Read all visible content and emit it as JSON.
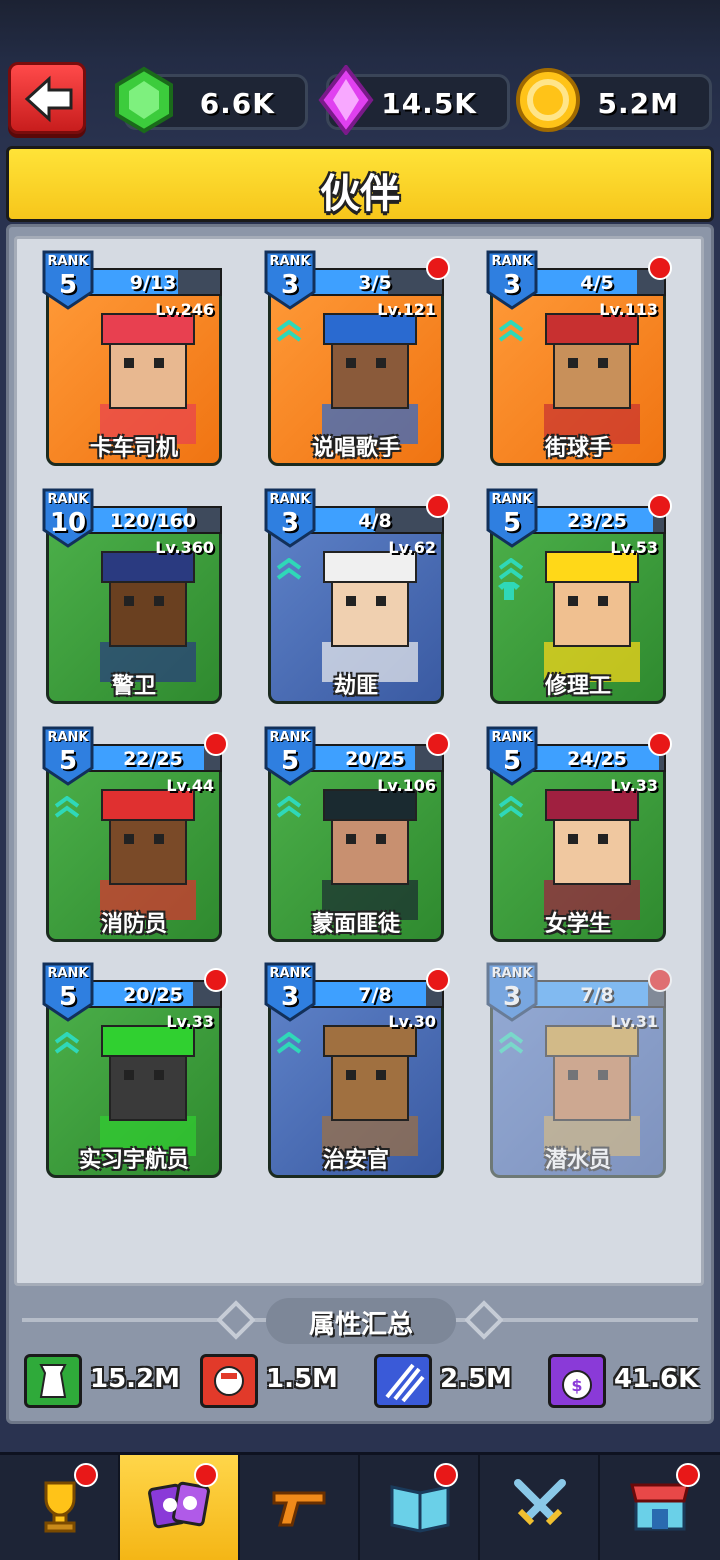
{
  "resources": {
    "gems": "6.6K",
    "crystals": "14.5K",
    "coins": "5.2M"
  },
  "title": "伙伴",
  "partners": [
    {
      "name": "卡车司机",
      "rank_label": "RANK",
      "rank": "5",
      "progress": "9/13",
      "progress_ratio": 0.69,
      "level": "Lv.246",
      "bg": "orange",
      "dot": false,
      "chevron": false
    },
    {
      "name": "说唱歌手",
      "rank_label": "RANK",
      "rank": "3",
      "progress": "3/5",
      "progress_ratio": 0.6,
      "level": "Lv.121",
      "bg": "orange",
      "dot": true,
      "chevron": true
    },
    {
      "name": "街球手",
      "rank_label": "RANK",
      "rank": "3",
      "progress": "4/5",
      "progress_ratio": 0.8,
      "level": "Lv.113",
      "bg": "orange",
      "dot": true,
      "chevron": true
    },
    {
      "name": "警卫",
      "rank_label": "RANK",
      "rank": "10",
      "progress": "120/160",
      "progress_ratio": 0.75,
      "level": "Lv.360",
      "bg": "green",
      "dot": false,
      "chevron": false
    },
    {
      "name": "劫匪",
      "rank_label": "RANK",
      "rank": "3",
      "progress": "4/8",
      "progress_ratio": 0.5,
      "level": "Lv.62",
      "bg": "blue",
      "dot": true,
      "chevron": true
    },
    {
      "name": "修理工",
      "rank_label": "RANK",
      "rank": "5",
      "progress": "23/25",
      "progress_ratio": 0.92,
      "level": "Lv.53",
      "bg": "green",
      "dot": true,
      "chevron": true
    },
    {
      "name": "消防员",
      "rank_label": "RANK",
      "rank": "5",
      "progress": "22/25",
      "progress_ratio": 0.88,
      "level": "Lv.44",
      "bg": "green",
      "dot": true,
      "chevron": true
    },
    {
      "name": "蒙面匪徒",
      "rank_label": "RANK",
      "rank": "5",
      "progress": "20/25",
      "progress_ratio": 0.8,
      "level": "Lv.106",
      "bg": "green",
      "dot": true,
      "chevron": true
    },
    {
      "name": "女学生",
      "rank_label": "RANK",
      "rank": "5",
      "progress": "24/25",
      "progress_ratio": 0.96,
      "level": "Lv.33",
      "bg": "green",
      "dot": true,
      "chevron": true
    },
    {
      "name": "实习宇航员",
      "rank_label": "RANK",
      "rank": "5",
      "progress": "20/25",
      "progress_ratio": 0.8,
      "level": "Lv.33",
      "bg": "green",
      "dot": true,
      "chevron": true
    },
    {
      "name": "治安官",
      "rank_label": "RANK",
      "rank": "3",
      "progress": "7/8",
      "progress_ratio": 0.875,
      "level": "Lv.30",
      "bg": "blue",
      "dot": true,
      "chevron": true
    },
    {
      "name": "潜水员",
      "rank_label": "RANK",
      "rank": "3",
      "progress": "7/8",
      "progress_ratio": 0.875,
      "level": "Lv.31",
      "bg": "blue",
      "dot": true,
      "chevron": true,
      "locked": true
    }
  ],
  "summary": {
    "title": "属性汇总",
    "stats": [
      {
        "value": "15.2M",
        "icon": "tower-icon",
        "color": "#2faa3a"
      },
      {
        "value": "1.5M",
        "icon": "fist-icon",
        "color": "#e23a2a"
      },
      {
        "value": "2.5M",
        "icon": "claw-icon",
        "color": "#3a5ad8"
      },
      {
        "value": "41.6K",
        "icon": "money-bag-icon",
        "color": "#8a3ad8"
      }
    ]
  },
  "nav": [
    {
      "icon": "trophy-icon",
      "dot": true
    },
    {
      "icon": "partners-icon",
      "dot": true,
      "active": true
    },
    {
      "icon": "gun-icon",
      "dot": false
    },
    {
      "icon": "book-icon",
      "dot": true
    },
    {
      "icon": "swords-icon",
      "dot": false
    },
    {
      "icon": "shop-icon",
      "dot": true
    }
  ]
}
